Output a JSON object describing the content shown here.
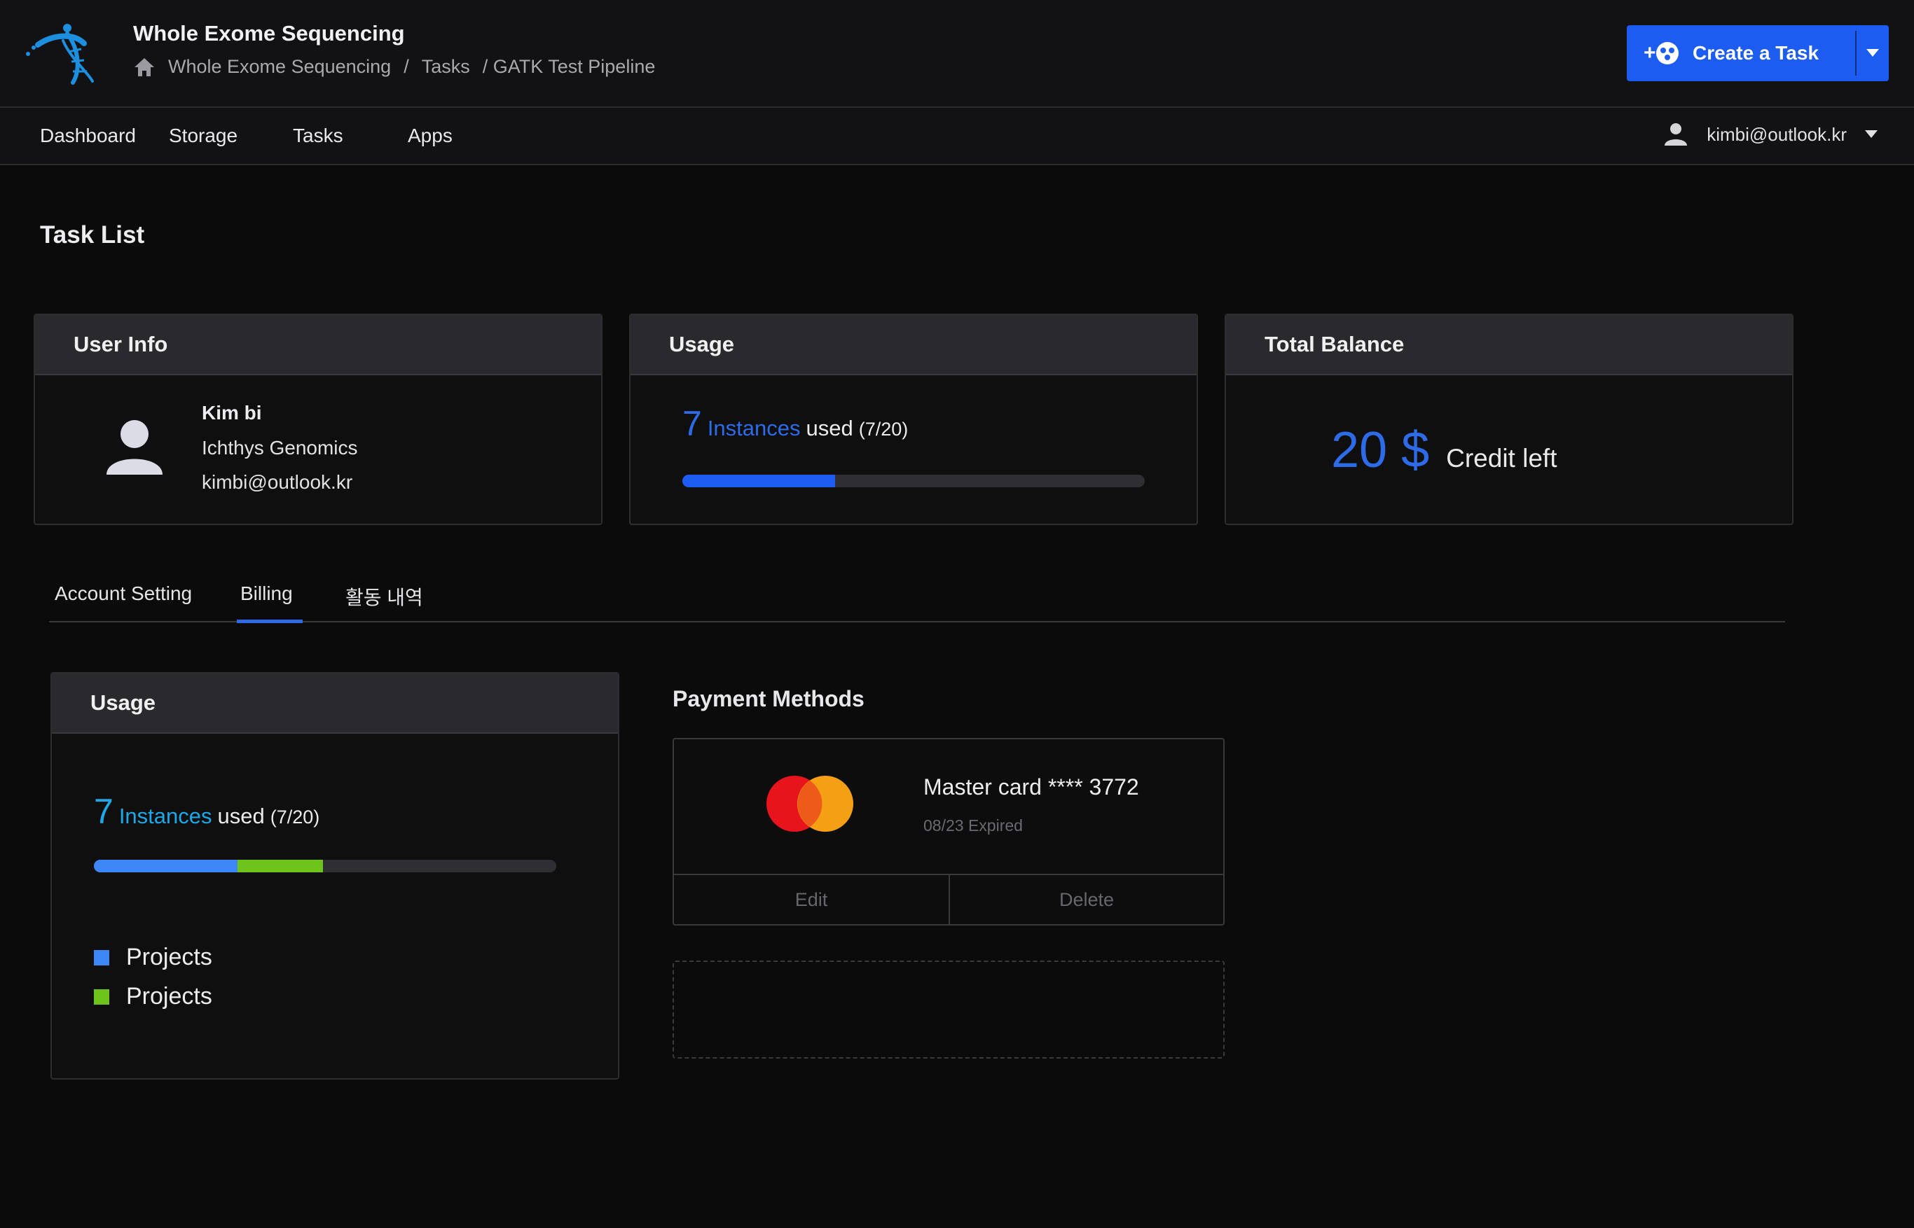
{
  "header": {
    "app_title": "Whole Exome Sequencing",
    "breadcrumb": [
      "Whole Exome Sequencing",
      "/",
      "Tasks",
      "/ GATK Test Pipeline"
    ],
    "create_task_label": "Create a Task"
  },
  "nav": {
    "items": [
      "Dashboard",
      "Storage",
      "Tasks",
      "Apps"
    ],
    "user_email": "kimbi@outlook.kr"
  },
  "page": {
    "title": "Task List"
  },
  "user_info": {
    "heading": "User Info",
    "name": "Kim bi",
    "organization": "Ichthys Genomics",
    "email": "kimbi@outlook.kr"
  },
  "usage_card": {
    "heading": "Usage",
    "count": "7",
    "instances_label": "Instances",
    "used_label": "used",
    "ratio": "(7/20)",
    "progress": 0.33
  },
  "balance_card": {
    "heading": "Total Balance",
    "amount": "20",
    "currency": "$",
    "label": "Credit left"
  },
  "tabs": {
    "items": [
      "Account Setting",
      "Billing",
      "활동 내역"
    ],
    "active": "Billing"
  },
  "billing_usage": {
    "heading": "Usage",
    "count": "7",
    "instances_label": "Instances",
    "used_label": "used",
    "ratio": "(7/20)",
    "segments": [
      {
        "color": "#3d86f5",
        "fraction": 0.31
      },
      {
        "color": "#6ec41a",
        "fraction": 0.185
      }
    ],
    "legend": [
      {
        "label": "Projects",
        "color": "#3d86f5"
      },
      {
        "label": "Projects",
        "color": "#6ec41a"
      }
    ]
  },
  "payment": {
    "title": "Payment Methods",
    "card_number": "Master card **** 3772",
    "expiry": "08/23 Expired",
    "edit_label": "Edit",
    "delete_label": "Delete"
  },
  "colors": {
    "accent": "#1c5cf0",
    "instances_blue": "#2d6be8",
    "instances_cyan": "#1fa8e8"
  }
}
